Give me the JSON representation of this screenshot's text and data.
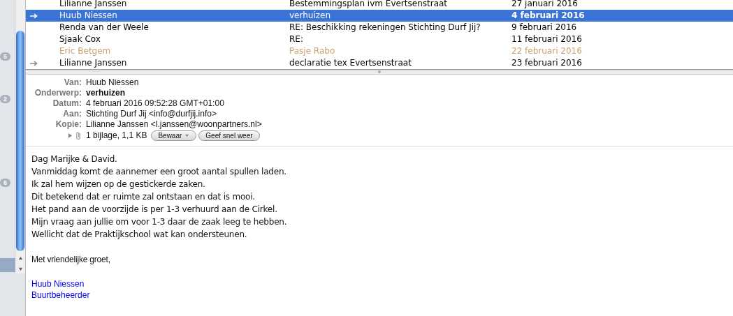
{
  "sidebar": {
    "badges": [
      "5",
      "2",
      "6"
    ]
  },
  "messages": [
    {
      "sender": "Lilianne Janssen",
      "subject": "Bestemmingsplan ivm Evertsenstraat",
      "date": "27 januari 2016",
      "replied": false,
      "selected": false
    },
    {
      "sender": "Huub Niessen",
      "subject": "verhuizen",
      "date": "4 februari 2016",
      "replied": true,
      "selected": true
    },
    {
      "sender": "Renda van der Weele",
      "subject": "RE: Beschikking rekeningen Stichting Durf Jij?",
      "date": "9 februari 2016",
      "replied": false,
      "selected": false
    },
    {
      "sender": "Sjaak Cox",
      "subject": "RE:",
      "date": "11 februari 2016",
      "replied": false,
      "selected": false
    },
    {
      "sender": "Eric Betgem",
      "subject": "Pasje Rabo",
      "date": "22 februari 2016",
      "replied": false,
      "selected": false,
      "color": "#c8a070"
    },
    {
      "sender": "Lilianne Janssen",
      "subject": "declaratie tex Evertsenstraat",
      "date": "23 februari 2016",
      "replied": true,
      "selected": false
    }
  ],
  "headers": [
    {
      "label": "Van:",
      "value": "Huub Niessen",
      "bold": false
    },
    {
      "label": "Onderwerp:",
      "value": "verhuizen",
      "bold": true
    },
    {
      "label": "Datum:",
      "value": "4 februari 2016 09:52:28 GMT+01:00",
      "bold": false
    },
    {
      "label": "Aan:",
      "value": "Stichting Durf Jij <info@durfjij.info>",
      "bold": false
    },
    {
      "label": "Kopie:",
      "value": "Lilianne Janssen <l.janssen@woonpartners.nl>",
      "bold": false
    }
  ],
  "attachment": {
    "summary": "1 bijlage, 1,1 KB",
    "buttons": [
      "Bewaar",
      "Geef snel weer"
    ]
  },
  "body": [
    "Dag Marijke & David.",
    "Vanmiddag komt de aannemer een groot aantal spullen laden.",
    "Ik zal hem wijzen op de gestickerde zaken.",
    "Dit betekend dat er ruimte zal ontstaan en dat is mooi.",
    "Het pand aan de voorzijde is per 1-3 verhuurd aan de Cirkel.",
    "Mijn vraag aan jullie om voor 1-3 daar de zaak leeg te hebben.",
    "Wellicht dat de Praktijkschool wat kan ondersteunen."
  ],
  "closing": "Met vriendelijke groet,",
  "signature": [
    "Huub Niessen",
    "Buurtbeheerder"
  ]
}
